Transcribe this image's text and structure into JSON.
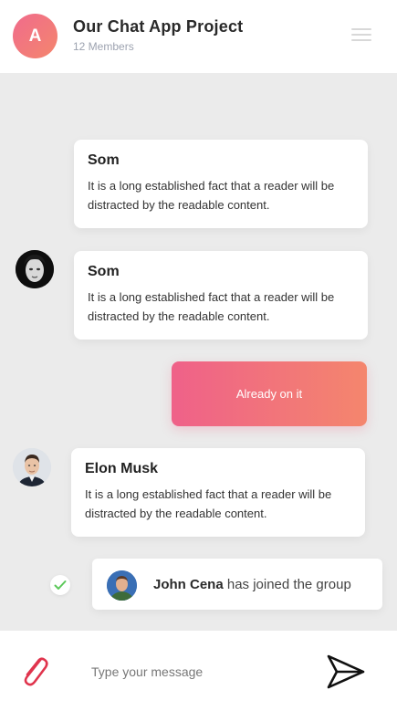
{
  "header": {
    "avatar_letter": "A",
    "title": "Our Chat App Project",
    "subtitle": "12 Members",
    "menu_icon": "hamburger-menu-icon"
  },
  "messages": [
    {
      "name": "Som",
      "text": "It is a long established fact that a reader will be distracted by the readable content."
    },
    {
      "name": "Som",
      "text": "It is a long established fact that a reader will be distracted by the readable content.",
      "avatar": "user-avatar"
    },
    {
      "own_text": "Already on it"
    },
    {
      "name": "Elon Musk",
      "text": "It is a long established fact that a reader will be distracted by the readable content.",
      "avatar": "user-avatar"
    }
  ],
  "system_message": {
    "name": "John Cena",
    "text": "has joined the group",
    "status_icon": "check-icon"
  },
  "composer": {
    "placeholder": "Type your message",
    "attach_icon": "paperclip-icon",
    "send_icon": "send-icon"
  },
  "colors": {
    "accent_start": "#ef6189",
    "accent_end": "#f4866d",
    "attach": "#e0344d",
    "check": "#5cc85a"
  }
}
